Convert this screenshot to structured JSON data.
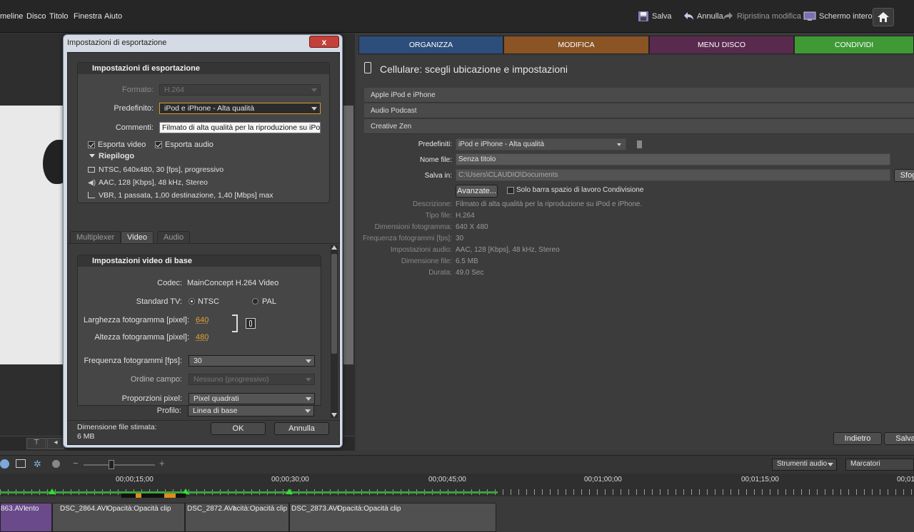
{
  "menubar": {
    "items": [
      "meline",
      "Disco",
      "Titolo",
      "Finestra",
      "Aiuto"
    ],
    "save_label": "Salva",
    "undo_label": "Annulla",
    "redo_label": "Ripristina modifica",
    "fullscreen_label": "Schermo intero"
  },
  "dialog": {
    "title": "Impostazioni di esportazione",
    "close_glyph": "x",
    "export_panel": {
      "heading": "Impostazioni di esportazione",
      "format_label": "Formato:",
      "format_value": "H.264",
      "preset_label": "Predefinito:",
      "preset_value": "iPod e iPhone - Alta qualità",
      "comments_label": "Commenti:",
      "comments_value": "Filmato di alta qualità per la riproduzione su iPod e iP",
      "export_video_label": "Esporta video",
      "export_audio_label": "Esporta audio",
      "summary_heading": "Riepilogo",
      "summary_video": "NTSC, 640x480, 30 [fps], progressivo",
      "summary_audio": "AAC, 128 [Kbps], 48 kHz, Stereo",
      "summary_bitrate": "VBR, 1 passata, 1,00 destinazione, 1,40 [Mbps] max"
    },
    "tabs": [
      "Multiplexer",
      "Video",
      "Audio"
    ],
    "video_panel": {
      "heading": "Impostazioni video di base",
      "codec_label": "Codec:",
      "codec_value": "MainConcept H.264 Video",
      "tv_label": "Standard TV:",
      "ntsc_label": "NTSC",
      "pal_label": "PAL",
      "width_label": "Larghezza fotogramma [pixel]:",
      "width_value": "640",
      "height_label": "Altezza fotogramma [pixel]:",
      "height_value": "480",
      "fps_label": "Frequenza fotogrammi [fps]:",
      "fps_value": "30",
      "field_label": "Ordine campo:",
      "field_value": "Nessuno (progressivo)",
      "aspect_label": "Proporzioni pixel:",
      "aspect_value": "Pixel quadrati",
      "profile_label": "Profilo:",
      "profile_value": "Linea di base"
    },
    "estimated_label": "Dimensione file stimata:",
    "estimated_value": "6 MB",
    "ok_label": "OK",
    "cancel_label": "Annulla"
  },
  "right_tabs": [
    {
      "label": "ORGANIZZA",
      "color": "#2d4e7a"
    },
    {
      "label": "MODIFICA",
      "color": "#8a5424"
    },
    {
      "label": "MENU DISCO",
      "color": "#5a2a4e"
    },
    {
      "label": "CONDIVIDI",
      "color": "#3f9a36"
    }
  ],
  "share": {
    "heading": "Cellulare: scegli ubicazione e impostazioni",
    "devices": [
      "Apple iPod e iPhone",
      "Audio Podcast",
      "Creative Zen"
    ],
    "preset_label": "Predefiniti:",
    "preset_value": "iPod e iPhone - Alta qualità",
    "filename_label": "Nome file:",
    "filename_value": "Senza titolo",
    "savein_label": "Salva in:",
    "savein_value": "C:\\Users\\CLAUDIO\\Documents",
    "browse_label": "Sfog",
    "advanced_label": "Avanzate...",
    "workspace_only_label": "Solo barra spazio di lavoro Condivisione",
    "info": [
      {
        "label": "Descrizione:",
        "value": "Filmato di alta qualità per la riproduzione su iPod e iPhone."
      },
      {
        "label": "Tipo file:",
        "value": "H.264"
      },
      {
        "label": "Dimensioni fotogramma:",
        "value": "640 X 480"
      },
      {
        "label": "Frequenza fotogrammi [fps]:",
        "value": "30"
      },
      {
        "label": "Impostazioni audio:",
        "value": "AAC, 128 [Kbps], 48 kHz, Stereo"
      },
      {
        "label": "Dimensione file:",
        "value": "6.5 MB"
      },
      {
        "label": "Durata:",
        "value": "49.0 Sec"
      }
    ],
    "back_label": "Indietro",
    "save_label": "Salva"
  },
  "timeline": {
    "audio_tools_label": "Strumenti audio",
    "markers_label": "Marcatori",
    "timecodes": [
      "00;00;15;00",
      "00;00;30;00",
      "00;00;45;00",
      "00;01;00;00",
      "00;01;15;00",
      "00;01;3"
    ],
    "clips": [
      {
        "name": "863.AVI",
        "extra": "ento"
      },
      {
        "name": "DSC_2864.AVI",
        "extra": "Opacità:Opacità clip"
      },
      {
        "name": "DSC_2872.AVI",
        "extra": "acità:Opacità clip"
      },
      {
        "name": "DSC_2873.AVI",
        "extra": "Opacità:Opacità clip"
      }
    ]
  }
}
